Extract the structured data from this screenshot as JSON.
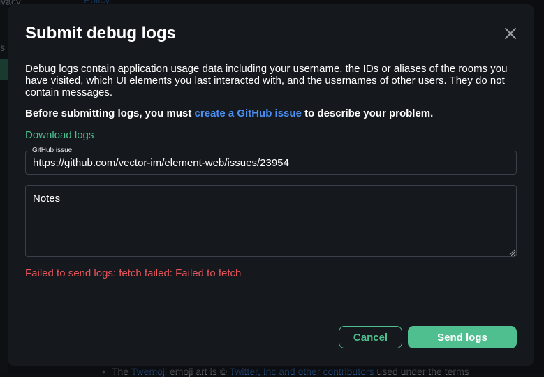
{
  "background": {
    "privacy_fragment": "ivacy",
    "s_fragment": "s",
    "top_link_fragment": "Policy.",
    "footer": {
      "prefix": "The ",
      "twemoji": "Twemoji",
      "middle": " emoji art is © ",
      "twitter": "Twitter, Inc and other contributors",
      "suffix": " used under the terms"
    }
  },
  "dialog": {
    "title": "Submit debug logs",
    "close_icon": "close-icon",
    "description": "Debug logs contain application usage data including your username, the IDs or aliases of the rooms you have visited, which UI elements you last interacted with, and the usernames of other users. They do not contain messages.",
    "prereq_before": "Before submitting logs, you must ",
    "prereq_link": "create a GitHub issue",
    "prereq_after": " to describe your problem.",
    "download_link": "Download logs",
    "github_field": {
      "label": "GitHub issue",
      "value": "https://github.com/vector-im/element-web/issues/23954"
    },
    "notes_field": {
      "placeholder": "Notes"
    },
    "error": "Failed to send logs: fetch failed: Failed to fetch",
    "cancel_label": "Cancel",
    "send_label": "Send logs"
  },
  "colors": {
    "accent": "#4fbf8f",
    "link": "#4a8ff4",
    "error": "#e5555b",
    "dialog_bg": "#15191e"
  }
}
